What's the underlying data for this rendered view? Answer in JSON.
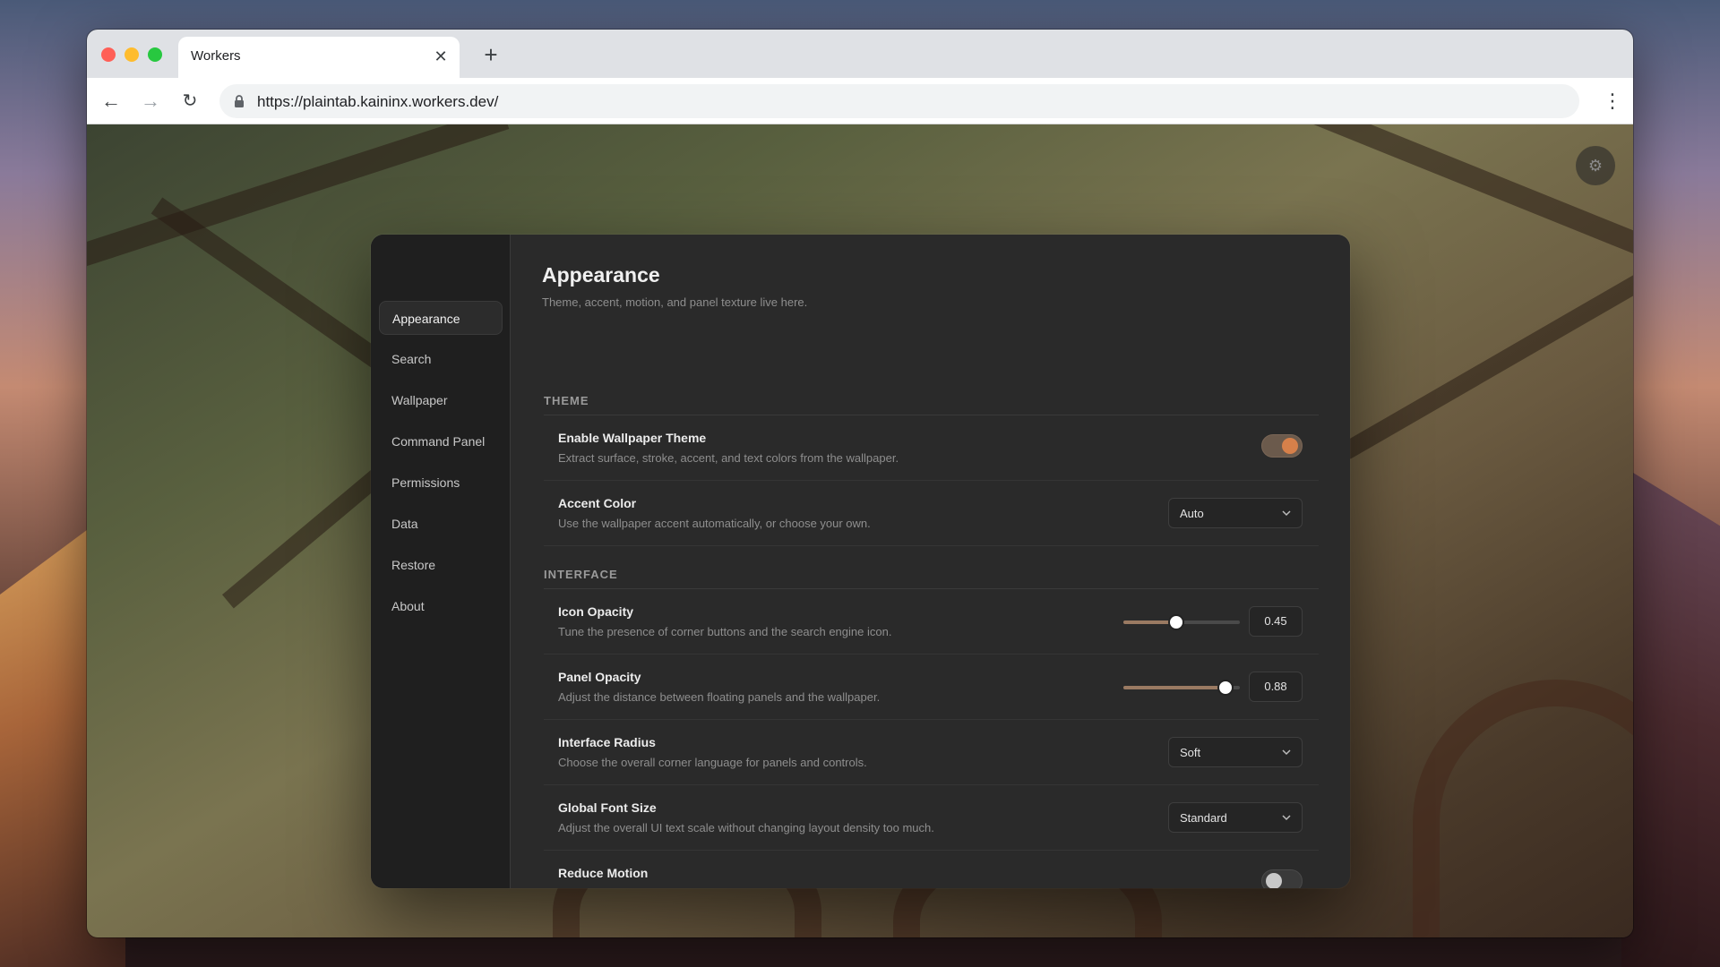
{
  "browser": {
    "tab_title": "Workers",
    "tab_close": "✕",
    "new_tab": "+",
    "url": "https://plaintab.kaininx.workers.dev/",
    "back": "←",
    "forward": "→",
    "reload": "↻",
    "menu": "⋮"
  },
  "page": {
    "gear": "⚙"
  },
  "sidebar": {
    "items": [
      {
        "label": "Appearance",
        "active": true
      },
      {
        "label": "Search"
      },
      {
        "label": "Wallpaper"
      },
      {
        "label": "Command Panel"
      },
      {
        "label": "Permissions"
      },
      {
        "label": "Data"
      },
      {
        "label": "Restore"
      },
      {
        "label": "About"
      }
    ]
  },
  "main": {
    "title": "Appearance",
    "subtitle": "Theme, accent, motion, and panel texture live here.",
    "sections": {
      "theme": "THEME",
      "interface": "INTERFACE"
    },
    "rows": {
      "wallpaper_theme": {
        "title": "Enable Wallpaper Theme",
        "desc": "Extract surface, stroke, accent, and text colors from the wallpaper.",
        "enabled": true
      },
      "accent_color": {
        "title": "Accent Color",
        "desc": "Use the wallpaper accent automatically, or choose your own.",
        "value": "Auto"
      },
      "icon_opacity": {
        "title": "Icon Opacity",
        "desc": "Tune the presence of corner buttons and the search engine icon.",
        "value": "0.45",
        "level": 0.45
      },
      "panel_opacity": {
        "title": "Panel Opacity",
        "desc": "Adjust the distance between floating panels and the wallpaper.",
        "value": "0.88",
        "level": 0.88
      },
      "interface_radius": {
        "title": "Interface Radius",
        "desc": "Choose the overall corner language for panels and controls.",
        "value": "Soft"
      },
      "global_font_size": {
        "title": "Global Font Size",
        "desc": "Adjust the overall UI text scale without changing layout density too much.",
        "value": "Standard"
      },
      "reduce_motion": {
        "title": "Reduce Motion",
        "enabled": false
      }
    }
  },
  "colors": {
    "accent": "#d6804a",
    "panel_bg": "#2a2a2a",
    "sidebar_bg": "#1f1f1f"
  }
}
